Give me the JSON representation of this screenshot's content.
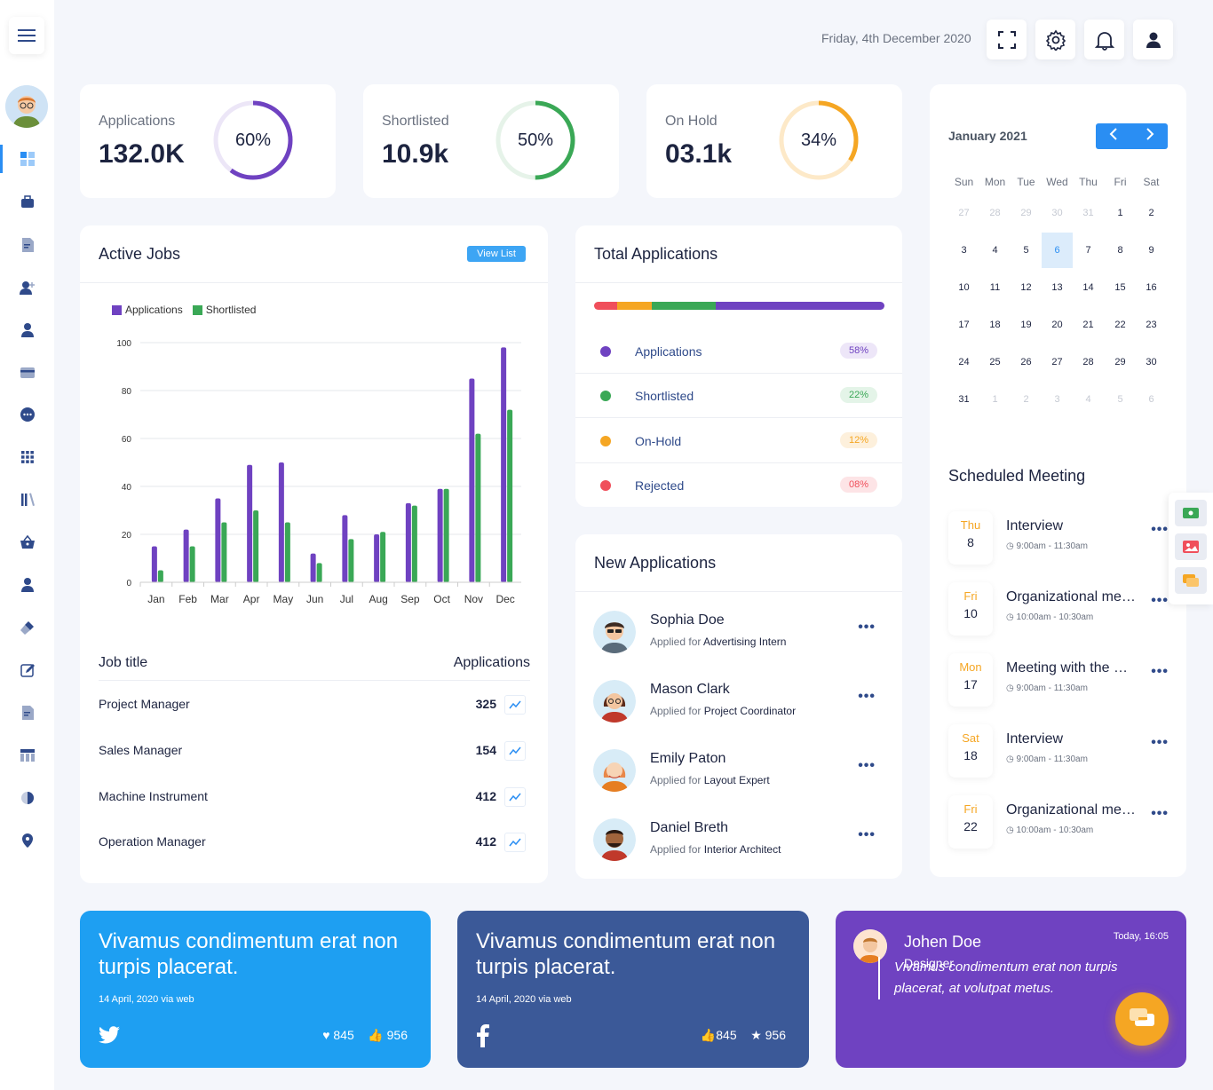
{
  "topbar": {
    "date": "Friday, 4th December 2020"
  },
  "stats": [
    {
      "label": "Applications",
      "value": "132.0K",
      "percent": 60,
      "percent_text": "60%",
      "color": "#6f42c1",
      "track": "#ece6f7"
    },
    {
      "label": "Shortlisted",
      "value": "10.9k",
      "percent": 50,
      "percent_text": "50%",
      "color": "#3aa856",
      "track": "#e6f3e9"
    },
    {
      "label": "On Hold",
      "value": "03.1k",
      "percent": 34,
      "percent_text": "34%",
      "color": "#f5a623",
      "track": "#fde9c8"
    }
  ],
  "active_jobs": {
    "title": "Active Jobs",
    "view_list": "View List",
    "legend": [
      "Applications",
      "Shortlisted"
    ],
    "table_headers": [
      "Job title",
      "Applications"
    ],
    "rows": [
      {
        "title": "Project Manager",
        "count": "325"
      },
      {
        "title": "Sales Manager",
        "count": "154"
      },
      {
        "title": "Machine Instrument",
        "count": "412"
      },
      {
        "title": "Operation Manager",
        "count": "412"
      }
    ]
  },
  "chart_data": {
    "type": "bar",
    "categories": [
      "Jan",
      "Feb",
      "Mar",
      "Apr",
      "May",
      "Jun",
      "Jul",
      "Aug",
      "Sep",
      "Oct",
      "Nov",
      "Dec"
    ],
    "series": [
      {
        "name": "Applications",
        "color": "#6f42c1",
        "values": [
          15,
          22,
          35,
          49,
          50,
          12,
          28,
          20,
          33,
          39,
          85,
          98
        ]
      },
      {
        "name": "Shortlisted",
        "color": "#3aa856",
        "values": [
          5,
          15,
          25,
          30,
          25,
          8,
          18,
          21,
          32,
          39,
          62,
          72
        ]
      }
    ],
    "yticks": [
      "0",
      "20",
      "40",
      "60",
      "80",
      "100"
    ],
    "ylim": [
      0,
      100
    ],
    "grid": true,
    "legend_position": "top-left"
  },
  "total_applications": {
    "title": "Total Applications",
    "bar": [
      {
        "color": "#f04f5b",
        "value": 8
      },
      {
        "color": "#f5a623",
        "value": 12
      },
      {
        "color": "#3aa856",
        "value": 22
      },
      {
        "color": "#6f42c1",
        "value": 58
      }
    ],
    "rows": [
      {
        "label": "Applications",
        "pill": "58%",
        "color": "#6f42c1",
        "pill_bg": "#ede6f8",
        "pill_fg": "#6f42c1"
      },
      {
        "label": "Shortlisted",
        "pill": "22%",
        "color": "#3aa856",
        "pill_bg": "#e4f4e8",
        "pill_fg": "#3aa856"
      },
      {
        "label": "On-Hold",
        "pill": "12%",
        "color": "#f5a623",
        "pill_bg": "#fdf0dc",
        "pill_fg": "#f5a623"
      },
      {
        "label": "Rejected",
        "pill": "08%",
        "color": "#f04f5b",
        "pill_bg": "#fde4e6",
        "pill_fg": "#f04f5b"
      }
    ]
  },
  "new_applications": {
    "title": "New Applications",
    "applied_for": "Applied for",
    "rows": [
      {
        "name": "Sophia Doe",
        "role": "Advertising Intern"
      },
      {
        "name": "Mason Clark",
        "role": "Project Coordinator"
      },
      {
        "name": "Emily Paton",
        "role": "Layout Expert"
      },
      {
        "name": "Daniel Breth",
        "role": "Interior Architect"
      }
    ]
  },
  "calendar": {
    "month": "January 2021",
    "dow": [
      "Sun",
      "Mon",
      "Tue",
      "Wed",
      "Thu",
      "Fri",
      "Sat"
    ],
    "weeks": [
      [
        "27",
        "28",
        "29",
        "30",
        "31",
        "1",
        "2"
      ],
      [
        "3",
        "4",
        "5",
        "6",
        "7",
        "8",
        "9"
      ],
      [
        "10",
        "11",
        "12",
        "13",
        "14",
        "15",
        "16"
      ],
      [
        "17",
        "18",
        "19",
        "20",
        "21",
        "22",
        "23"
      ],
      [
        "24",
        "25",
        "26",
        "27",
        "28",
        "29",
        "30"
      ],
      [
        "31",
        "1",
        "2",
        "3",
        "4",
        "5",
        "6"
      ]
    ],
    "selected": "6"
  },
  "meetings": {
    "title": "Scheduled Meeting",
    "items": [
      {
        "day": "Thu",
        "date": "8",
        "title": "Interview",
        "time": "9:00am - 11:30am"
      },
      {
        "day": "Fri",
        "date": "10",
        "title": "Organizational meeting",
        "time": "10:00am - 10:30am"
      },
      {
        "day": "Mon",
        "date": "17",
        "title": "Meeting with the manager",
        "time": "9:00am - 11:30am"
      },
      {
        "day": "Sat",
        "date": "18",
        "title": "Interview",
        "time": "9:00am - 11:30am"
      },
      {
        "day": "Fri",
        "date": "22",
        "title": "Organizational meeting",
        "time": "10:00am - 10:30am"
      }
    ]
  },
  "social": [
    {
      "text": "Vivamus condimentum erat non turpis placerat.",
      "meta": "14 April, 2020 via web",
      "stat1": "845",
      "stat2": "956",
      "color": "#1e9ff2"
    },
    {
      "text": "Vivamus condimentum erat non turpis placerat.",
      "meta": "14 April, 2020 via web",
      "stat1": "845",
      "stat2": "956",
      "color": "#3b5998"
    }
  ],
  "testimonial": {
    "name": "Johen Doe",
    "role": "Designer",
    "time": "Today, 16:05",
    "quote": "Vivamus condimentum erat non turpis placerat, at volutpat metus.",
    "color": "#6f42c1"
  }
}
